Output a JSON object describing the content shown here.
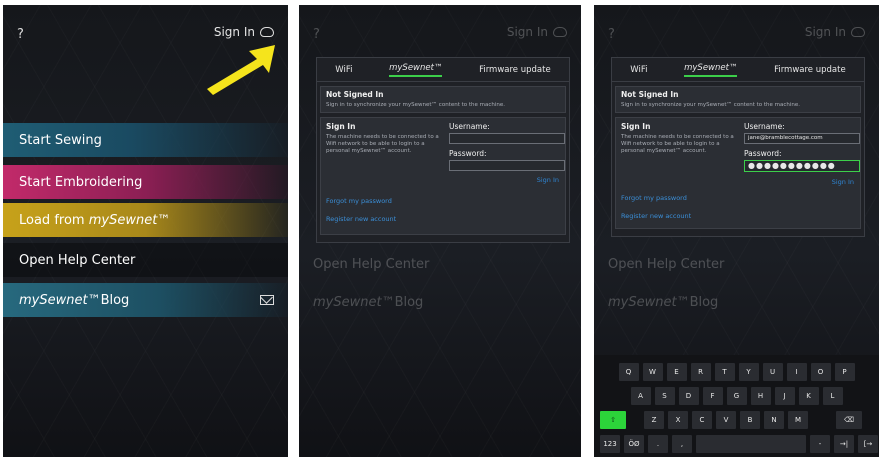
{
  "common": {
    "help_icon": "?",
    "sign_in_label": "Sign In",
    "cloud_icon": "cloud-icon"
  },
  "home": {
    "arrow_color": "#f5e41c",
    "menu": [
      {
        "label": "Start Sewing",
        "color": "#1f5d74"
      },
      {
        "label": "Start Embroidering",
        "color": "#c22a6a"
      },
      {
        "label_prefix": "Load from ",
        "label_brand": "mySewnet™",
        "color": "#c7a21a"
      },
      {
        "label": "Open Help Center"
      },
      {
        "label_brand": "mySewnet™",
        "label_suffix": " Blog",
        "color": "#27697e"
      }
    ]
  },
  "ghost_menu": {
    "help": "Open Help Center",
    "blog_brand": "mySewnet™",
    "blog_suffix": " Blog"
  },
  "dialog": {
    "tabs": [
      "WiFi",
      "mySewnet™",
      "Firmware update"
    ],
    "active_tab": 1,
    "status_title": "Not Signed In",
    "status_text": "Sign in to synchronize your mySewnet™ content to the machine.",
    "login_title": "Sign In",
    "login_text": "The machine needs to be connected to a Wifi network to be able to login to a personal mySewnet™ account.",
    "username_label": "Username:",
    "password_label": "Password:",
    "sign_in_button": "Sign In",
    "forgot_link": "Forgot my password",
    "register_link": "Register new account"
  },
  "filled": {
    "username_value": "jane@bramblecottage.com",
    "password_value": "●●●●●●●●●●●"
  },
  "keyboard": {
    "row1": [
      "Q",
      "W",
      "E",
      "R",
      "T",
      "Y",
      "U",
      "I",
      "O",
      "P"
    ],
    "row2": [
      "A",
      "S",
      "D",
      "F",
      "G",
      "H",
      "J",
      "K",
      "L"
    ],
    "row3": [
      "Z",
      "X",
      "C",
      "V",
      "B",
      "N",
      "M"
    ],
    "shift": "⇧",
    "backspace": "⌫",
    "numbers": "123",
    "special": "ÖØ",
    "period": ".",
    "comma": ",",
    "dash": "-",
    "tab": "→|",
    "enter": "[→"
  },
  "accent_green": "#3ccf4a",
  "link_blue": "#3b8fd8"
}
